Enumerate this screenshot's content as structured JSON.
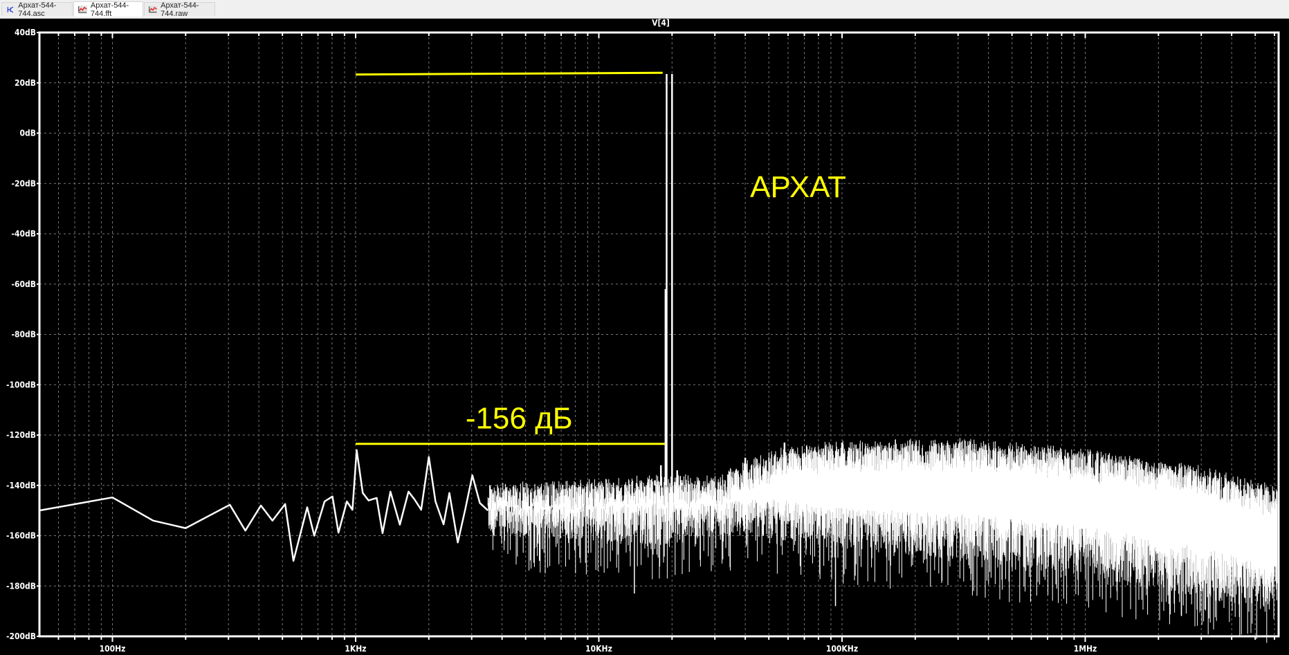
{
  "tabs": [
    {
      "label": "Архат-544-744.asc",
      "icon": "schematic-icon",
      "active": false
    },
    {
      "label": "Архат-544-744.fft",
      "icon": "waveform-icon",
      "active": true
    },
    {
      "label": "Архат-544-744.raw",
      "icon": "waveform-icon",
      "active": false
    }
  ],
  "colors": {
    "background": "#000000",
    "trace": "#ffffff",
    "annotation": "#ffff00",
    "grid": "#808080"
  },
  "chart_data": {
    "type": "line",
    "title": "V[4]",
    "xscale": "log",
    "xlim_hz": [
      50,
      6200000
    ],
    "ylim_db": [
      -200,
      40
    ],
    "grid": true,
    "y_ticks": [
      "40dB",
      "20dB",
      "0dB",
      "-20dB",
      "-40dB",
      "-60dB",
      "-80dB",
      "-100dB",
      "-120dB",
      "-140dB",
      "-160dB",
      "-180dB",
      "-200dB"
    ],
    "y_tick_values": [
      40,
      20,
      0,
      -20,
      -40,
      -60,
      -80,
      -100,
      -120,
      -140,
      -160,
      -180,
      -200
    ],
    "x_ticks": [
      "100Hz",
      "1KHz",
      "10KHz",
      "100KHz",
      "1MHz"
    ],
    "x_tick_values": [
      100,
      1000,
      10000,
      100000,
      1000000
    ],
    "trace_low_freq": [
      [
        50,
        -150
      ],
      [
        100,
        -144.8
      ],
      [
        147,
        -154
      ],
      [
        200,
        -157
      ],
      [
        304,
        -147.7
      ],
      [
        352,
        -158
      ],
      [
        408,
        -148
      ],
      [
        455,
        -154
      ],
      [
        513,
        -147.4
      ],
      [
        555,
        -170
      ],
      [
        632,
        -148.7
      ],
      [
        676,
        -160
      ],
      [
        745,
        -146.4
      ],
      [
        803,
        -144.4
      ],
      [
        850,
        -158.8
      ],
      [
        920,
        -146.4
      ],
      [
        970,
        -149.7
      ],
      [
        1010,
        -126
      ],
      [
        1070,
        -143
      ],
      [
        1130,
        -146
      ],
      [
        1220,
        -145
      ],
      [
        1290,
        -159
      ],
      [
        1390,
        -142.5
      ],
      [
        1520,
        -155.6
      ],
      [
        1650,
        -142.5
      ],
      [
        1750,
        -145.7
      ],
      [
        1860,
        -149.7
      ],
      [
        2000,
        -128.7
      ],
      [
        2130,
        -146.4
      ],
      [
        2300,
        -155.5
      ],
      [
        2430,
        -143
      ],
      [
        2630,
        -162.7
      ],
      [
        2820,
        -149.7
      ],
      [
        3020,
        -136
      ],
      [
        3240,
        -147
      ],
      [
        3500,
        -150
      ]
    ],
    "noise_envelope": {
      "freq": [
        3500,
        10000,
        20000,
        30000,
        40000,
        60000,
        100000,
        300000,
        1000000,
        3000000,
        6200000
      ],
      "upper_db": [
        -143,
        -141,
        -139,
        -140,
        -134,
        -128,
        -126,
        -125,
        -129,
        -136,
        -144
      ],
      "lower_db": [
        -160,
        -162,
        -164,
        -160,
        -160,
        -162,
        -165,
        -170,
        -176,
        -185,
        -192
      ]
    },
    "spikes": [
      {
        "freq": 19000,
        "db": 23.5
      },
      {
        "freq": 20000,
        "db": 23.5
      },
      {
        "freq": 18800,
        "db": -62
      },
      {
        "freq": 17000,
        "db": -138
      },
      {
        "freq": 18000,
        "db": -132
      },
      {
        "freq": 21000,
        "db": -134
      },
      {
        "freq": 22000,
        "db": -139
      },
      {
        "freq": 40000,
        "db": -129
      },
      {
        "freq": 58000,
        "db": -123
      },
      {
        "freq": 100000,
        "db": -123
      },
      {
        "freq": 5700,
        "db": -170
      },
      {
        "freq": 14000,
        "db": -183
      },
      {
        "freq": 94000,
        "db": -188
      }
    ],
    "annotations": {
      "top_line": {
        "from_hz": 1000,
        "to_hz": 18300,
        "db_start": 23.3,
        "db_end": 24
      },
      "bottom_line": {
        "from_hz": 1000,
        "to_hz": 18700,
        "db": -123.5
      },
      "level_text": {
        "text": "-156 дБ",
        "freq": 4700,
        "db": -113
      },
      "name_text": {
        "text": "АРХАТ",
        "freq": 66000,
        "db": -21
      }
    }
  }
}
